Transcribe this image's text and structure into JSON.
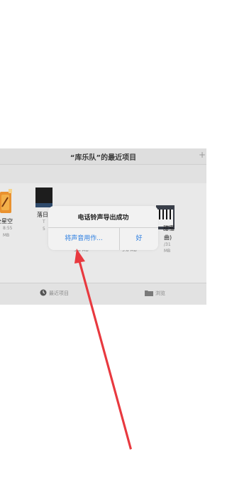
{
  "header": {
    "title": "“库乐队”的最近项目",
    "add_icon_glyph": "+"
  },
  "files": [
    {
      "name": "全星空",
      "line2": "8:55",
      "size": "MB",
      "thumb": "orange-guitar"
    },
    {
      "name": "落日",
      "line2": "T",
      "size": "5",
      "thumb": "dark"
    },
    {
      "name": "",
      "line2": "",
      "size": "5.8 MB",
      "thumb": "none"
    },
    {
      "name": "",
      "line2": "",
      "size": "5.8 MB",
      "thumb": "none"
    },
    {
      "name": "甜蜜",
      "line2": "曲)",
      "size": "/31",
      "thumb": "piano"
    }
  ],
  "file_size_extra": "MB",
  "dialog": {
    "title": "电话铃声导出成功",
    "left_button": "将声音用作...",
    "right_button": "好"
  },
  "tabs": [
    {
      "label": "最近项目",
      "icon": "clock-icon"
    },
    {
      "label": "浏览",
      "icon": "folder-icon"
    }
  ],
  "colors": {
    "accent": "#2a7de1",
    "arrow": "#e8393f"
  }
}
